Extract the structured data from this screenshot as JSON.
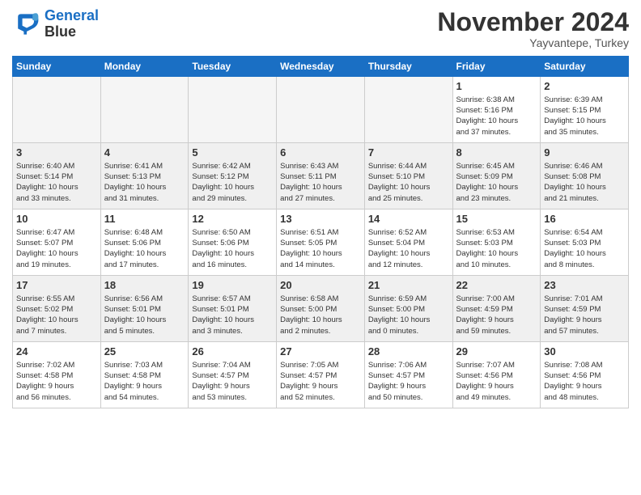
{
  "logo": {
    "line1": "General",
    "line2": "Blue"
  },
  "title": "November 2024",
  "location": "Yayvantepe, Turkey",
  "weekdays": [
    "Sunday",
    "Monday",
    "Tuesday",
    "Wednesday",
    "Thursday",
    "Friday",
    "Saturday"
  ],
  "weeks": [
    [
      {
        "day": "",
        "info": ""
      },
      {
        "day": "",
        "info": ""
      },
      {
        "day": "",
        "info": ""
      },
      {
        "day": "",
        "info": ""
      },
      {
        "day": "",
        "info": ""
      },
      {
        "day": "1",
        "info": "Sunrise: 6:38 AM\nSunset: 5:16 PM\nDaylight: 10 hours\nand 37 minutes."
      },
      {
        "day": "2",
        "info": "Sunrise: 6:39 AM\nSunset: 5:15 PM\nDaylight: 10 hours\nand 35 minutes."
      }
    ],
    [
      {
        "day": "3",
        "info": "Sunrise: 6:40 AM\nSunset: 5:14 PM\nDaylight: 10 hours\nand 33 minutes."
      },
      {
        "day": "4",
        "info": "Sunrise: 6:41 AM\nSunset: 5:13 PM\nDaylight: 10 hours\nand 31 minutes."
      },
      {
        "day": "5",
        "info": "Sunrise: 6:42 AM\nSunset: 5:12 PM\nDaylight: 10 hours\nand 29 minutes."
      },
      {
        "day": "6",
        "info": "Sunrise: 6:43 AM\nSunset: 5:11 PM\nDaylight: 10 hours\nand 27 minutes."
      },
      {
        "day": "7",
        "info": "Sunrise: 6:44 AM\nSunset: 5:10 PM\nDaylight: 10 hours\nand 25 minutes."
      },
      {
        "day": "8",
        "info": "Sunrise: 6:45 AM\nSunset: 5:09 PM\nDaylight: 10 hours\nand 23 minutes."
      },
      {
        "day": "9",
        "info": "Sunrise: 6:46 AM\nSunset: 5:08 PM\nDaylight: 10 hours\nand 21 minutes."
      }
    ],
    [
      {
        "day": "10",
        "info": "Sunrise: 6:47 AM\nSunset: 5:07 PM\nDaylight: 10 hours\nand 19 minutes."
      },
      {
        "day": "11",
        "info": "Sunrise: 6:48 AM\nSunset: 5:06 PM\nDaylight: 10 hours\nand 17 minutes."
      },
      {
        "day": "12",
        "info": "Sunrise: 6:50 AM\nSunset: 5:06 PM\nDaylight: 10 hours\nand 16 minutes."
      },
      {
        "day": "13",
        "info": "Sunrise: 6:51 AM\nSunset: 5:05 PM\nDaylight: 10 hours\nand 14 minutes."
      },
      {
        "day": "14",
        "info": "Sunrise: 6:52 AM\nSunset: 5:04 PM\nDaylight: 10 hours\nand 12 minutes."
      },
      {
        "day": "15",
        "info": "Sunrise: 6:53 AM\nSunset: 5:03 PM\nDaylight: 10 hours\nand 10 minutes."
      },
      {
        "day": "16",
        "info": "Sunrise: 6:54 AM\nSunset: 5:03 PM\nDaylight: 10 hours\nand 8 minutes."
      }
    ],
    [
      {
        "day": "17",
        "info": "Sunrise: 6:55 AM\nSunset: 5:02 PM\nDaylight: 10 hours\nand 7 minutes."
      },
      {
        "day": "18",
        "info": "Sunrise: 6:56 AM\nSunset: 5:01 PM\nDaylight: 10 hours\nand 5 minutes."
      },
      {
        "day": "19",
        "info": "Sunrise: 6:57 AM\nSunset: 5:01 PM\nDaylight: 10 hours\nand 3 minutes."
      },
      {
        "day": "20",
        "info": "Sunrise: 6:58 AM\nSunset: 5:00 PM\nDaylight: 10 hours\nand 2 minutes."
      },
      {
        "day": "21",
        "info": "Sunrise: 6:59 AM\nSunset: 5:00 PM\nDaylight: 10 hours\nand 0 minutes."
      },
      {
        "day": "22",
        "info": "Sunrise: 7:00 AM\nSunset: 4:59 PM\nDaylight: 9 hours\nand 59 minutes."
      },
      {
        "day": "23",
        "info": "Sunrise: 7:01 AM\nSunset: 4:59 PM\nDaylight: 9 hours\nand 57 minutes."
      }
    ],
    [
      {
        "day": "24",
        "info": "Sunrise: 7:02 AM\nSunset: 4:58 PM\nDaylight: 9 hours\nand 56 minutes."
      },
      {
        "day": "25",
        "info": "Sunrise: 7:03 AM\nSunset: 4:58 PM\nDaylight: 9 hours\nand 54 minutes."
      },
      {
        "day": "26",
        "info": "Sunrise: 7:04 AM\nSunset: 4:57 PM\nDaylight: 9 hours\nand 53 minutes."
      },
      {
        "day": "27",
        "info": "Sunrise: 7:05 AM\nSunset: 4:57 PM\nDaylight: 9 hours\nand 52 minutes."
      },
      {
        "day": "28",
        "info": "Sunrise: 7:06 AM\nSunset: 4:57 PM\nDaylight: 9 hours\nand 50 minutes."
      },
      {
        "day": "29",
        "info": "Sunrise: 7:07 AM\nSunset: 4:56 PM\nDaylight: 9 hours\nand 49 minutes."
      },
      {
        "day": "30",
        "info": "Sunrise: 7:08 AM\nSunset: 4:56 PM\nDaylight: 9 hours\nand 48 minutes."
      }
    ]
  ]
}
